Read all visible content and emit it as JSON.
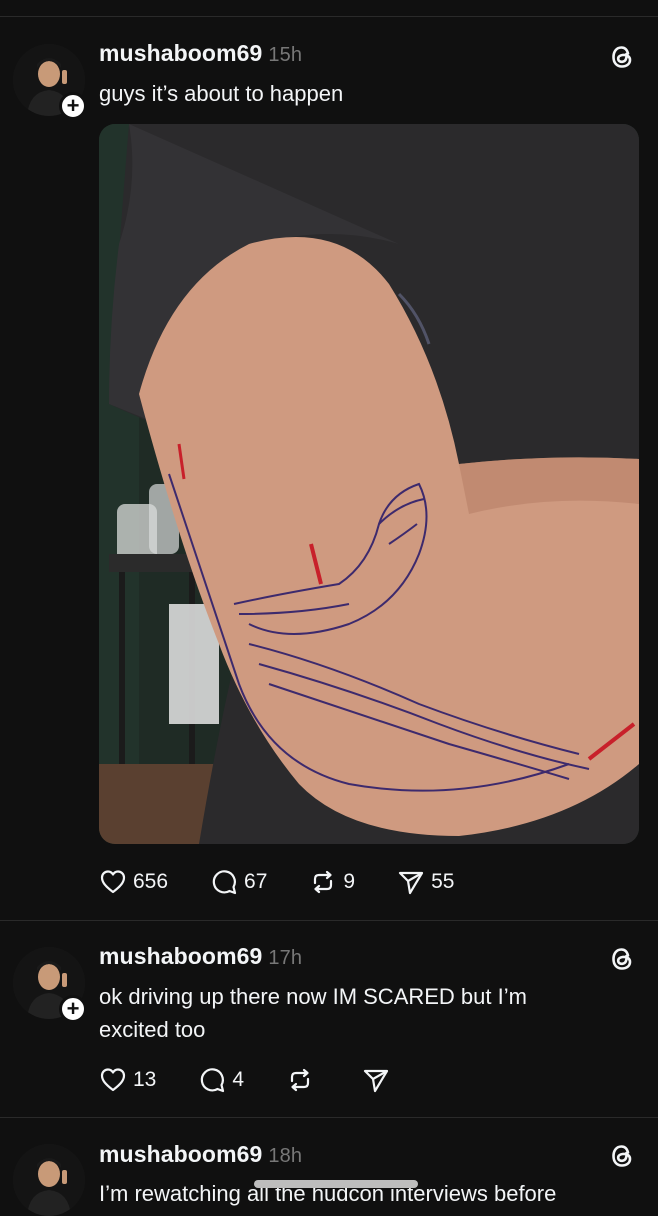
{
  "posts": [
    {
      "username": "mushaboom69",
      "time": "15h",
      "text": "guys it’s about to happen",
      "likes": "656",
      "replies": "67",
      "reposts": "9",
      "shares": "55",
      "image": "arm-tattoo-stencil-photo"
    },
    {
      "username": "mushaboom69",
      "time": "17h",
      "text": "ok driving up there now IM SCARED but I’m excited too",
      "likes": "13",
      "replies": "4",
      "reposts": "",
      "shares": ""
    },
    {
      "username": "mushaboom69",
      "time": "18h",
      "text": "I’m rewatching all the hudcon interviews before"
    }
  ],
  "icons": {
    "like": "heart-icon",
    "reply": "comment-icon",
    "repost": "repost-icon",
    "share": "send-icon",
    "brand": "threads-logo-icon",
    "follow": "plus-icon"
  },
  "colors": {
    "background": "#101010",
    "text": "#f3f5f7",
    "muted": "#777777",
    "divider": "#2a2a2a"
  }
}
